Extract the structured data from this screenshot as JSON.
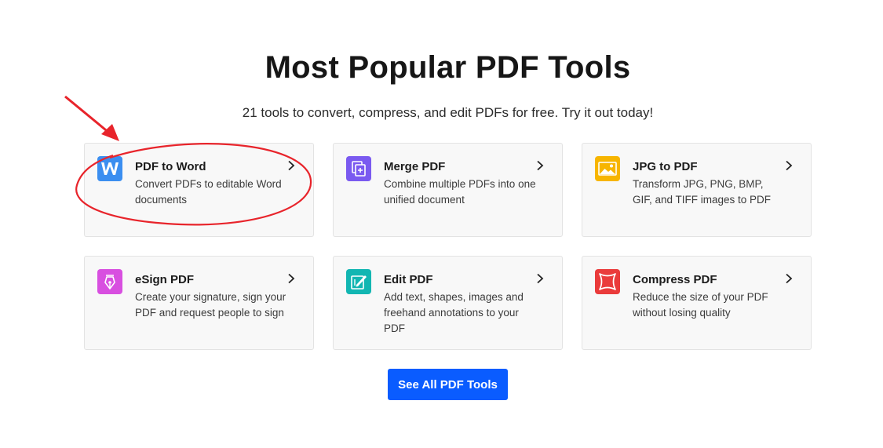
{
  "header": {
    "title": "Most Popular PDF Tools",
    "subtitle": "21 tools to convert, compress, and edit PDFs for free. Try it out today!"
  },
  "tools": [
    {
      "name": "PDF to Word",
      "desc": "Convert PDFs to editable Word documents",
      "icon": "word-icon",
      "color": "#3b8ef0"
    },
    {
      "name": "Merge PDF",
      "desc": "Combine multiple PDFs into one unified document",
      "icon": "merge-icon",
      "color": "#7a5af0"
    },
    {
      "name": "JPG to PDF",
      "desc": "Transform JPG, PNG, BMP, GIF, and TIFF images to PDF",
      "icon": "image-icon",
      "color": "#f7b500"
    },
    {
      "name": "eSign PDF",
      "desc": "Create your signature, sign your PDF and request people to sign",
      "icon": "pen-nib-icon",
      "color": "#d84fe0"
    },
    {
      "name": "Edit PDF",
      "desc": "Add text, shapes, images and freehand annotations to your PDF",
      "icon": "edit-icon",
      "color": "#12b6b2"
    },
    {
      "name": "Compress PDF",
      "desc": "Reduce the size of your PDF without losing quality",
      "icon": "compress-icon",
      "color": "#ea3b3b"
    }
  ],
  "cta": {
    "label": "See All PDF Tools",
    "color": "#0a5cff"
  },
  "annotation": {
    "color": "#e8242b"
  }
}
